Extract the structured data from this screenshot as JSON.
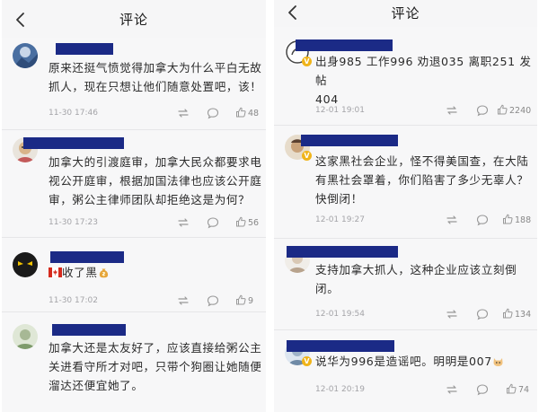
{
  "colors": {
    "redaction": "#1b2a86",
    "background": "#f7f7f8",
    "muted": "#a4a4a8"
  },
  "left": {
    "nav": {
      "back_icon": "chevron-left-icon",
      "title": "评论"
    },
    "comments": [
      {
        "line1": "原来还挺气愤觉得加拿大为什么平白无故",
        "line2": "抓人，现在只想让他们随意处置吧，该！",
        "time": "11-30 17:46",
        "likes": "48"
      },
      {
        "line1": "加拿大的引渡庭审，加拿大民众都要求电",
        "line2": "视公开庭审，根据加国法律也应该公开庭",
        "line3": "审，粥公主律师团队却拒绝这是为何？",
        "time": "11-30 17:23",
        "likes": "56"
      },
      {
        "text": "收了黑",
        "flag_icon": "canada-flag-icon",
        "emoji_icon": "money-bag-icon",
        "time": "11-30 17:02",
        "likes": "9"
      },
      {
        "line1": "加拿大还是太友好了，应该直接给粥公主",
        "line2": "关进看守所才对吧，只带个狗圈让她随便",
        "line3": "溜达还便宜她了。"
      }
    ]
  },
  "right": {
    "nav": {
      "back_icon": "chevron-left-icon",
      "title": "评论"
    },
    "comments": [
      {
        "line1": "出身985 工作996 劝退035 离职251 发帖",
        "line2": "404",
        "time": "12-01 19:01",
        "likes": "2240"
      },
      {
        "line1": "这家黑社会企业，怪不得美国查，在大陆",
        "line2": "有黑社会罩着，你们陷害了多少无辜人？",
        "line3": "快倒闭！",
        "time": "12-01 19:27",
        "likes": "188"
      },
      {
        "line1": "支持加拿大抓人，这种企业应该立刻倒",
        "line2": "闭。",
        "time": "12-01 19:54",
        "likes": "134"
      },
      {
        "text": "说华为996是造谣吧。明明是007",
        "emoji_icon": "cat-emoji-icon",
        "time": "12-01 20:19",
        "likes": "74"
      }
    ]
  }
}
